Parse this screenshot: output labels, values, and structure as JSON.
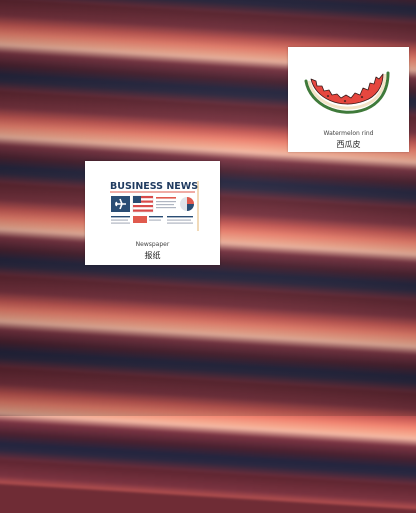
{
  "background": {
    "colors": [
      "#5e2530",
      "#f0826f",
      "#f6a98f",
      "#23253f"
    ]
  },
  "cards": [
    {
      "id": "newspaper",
      "icon": "newspaper-icon",
      "headline": "BUSINESS NEWS",
      "label_en": "Newspaper",
      "label_zh": "报纸"
    },
    {
      "id": "watermelon-rind",
      "icon": "watermelon-rind-icon",
      "label_en": "Watermelon rind",
      "label_zh": "西瓜皮"
    }
  ]
}
